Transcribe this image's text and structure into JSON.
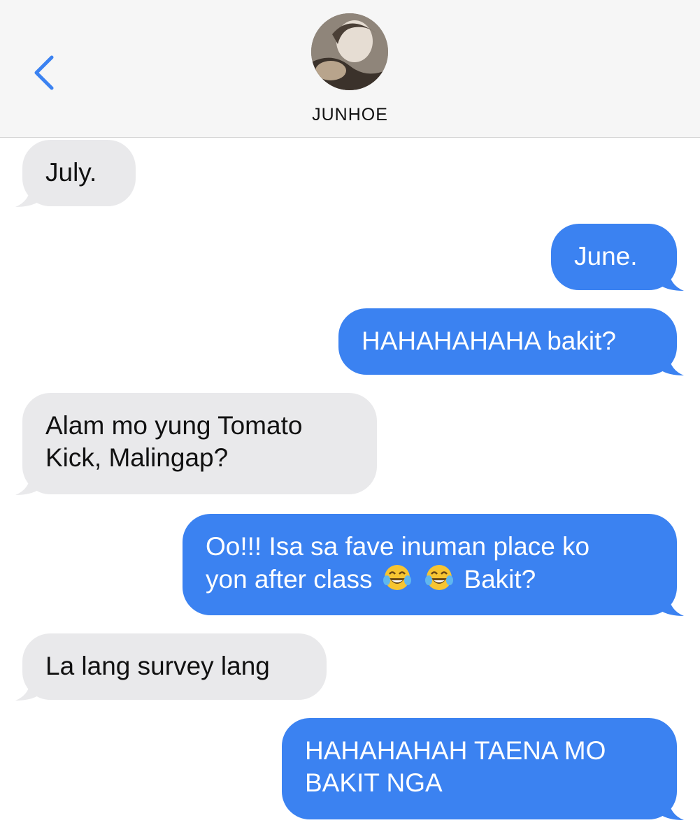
{
  "header": {
    "contact_name": "JUNHOE",
    "back_icon": "chevron-left-icon",
    "accent_color": "#3b82f1"
  },
  "messages": [
    {
      "direction": "incoming",
      "text": "July."
    },
    {
      "direction": "outgoing",
      "text": "June."
    },
    {
      "direction": "outgoing",
      "text": "HAHAHAHAHA bakit?"
    },
    {
      "direction": "incoming",
      "line1": "Alam mo yung Tomato",
      "line2": "Kick, Malingap?"
    },
    {
      "direction": "outgoing",
      "line1": "Oo!!! Isa sa fave inuman place ko",
      "line2_pre": "yon after class",
      "emoji": "face-with-tears-of-joy-icon",
      "line2_post": "Bakit?"
    },
    {
      "direction": "incoming",
      "text": "La lang survey lang"
    },
    {
      "direction": "outgoing",
      "line1": "HAHAHAHAH TAENA MO",
      "line2": "BAKIT NGA"
    }
  ],
  "colors": {
    "incoming_bubble": "#e9e9eb",
    "outgoing_bubble": "#3b82f1",
    "header_bg": "#f6f6f6"
  }
}
